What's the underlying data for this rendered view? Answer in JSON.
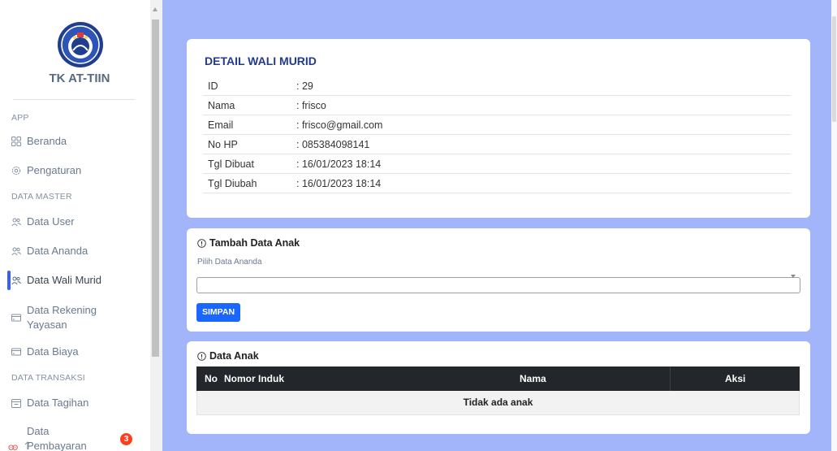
{
  "sidebar": {
    "brand": "TK AT-TIIN",
    "headers": {
      "app": "APP",
      "master": "DATA MASTER",
      "transaksi": "DATA TRANSAKSI"
    },
    "items": {
      "beranda": "Beranda",
      "pengaturan": "Pengaturan",
      "data_user": "Data User",
      "data_ananda": "Data Ananda",
      "data_wali_murid": "Data Wali Murid",
      "data_rekening_1": "Data Rekening",
      "data_rekening_2": "Yayasan",
      "data_biaya": "Data Biaya",
      "data_tagihan": "Data Tagihan",
      "data_pembayaran_1": "Data",
      "data_pembayaran_2": "Pembayaran"
    },
    "pembayaran_badge": "3",
    "accent_color": "#3b5cf6"
  },
  "detail": {
    "title": "DETAIL WALI MURID",
    "rows": [
      {
        "label": "ID",
        "value": ": 29"
      },
      {
        "label": "Nama",
        "value": ": frisco"
      },
      {
        "label": "Email",
        "value": ": frisco@gmail.com"
      },
      {
        "label": "No HP",
        "value": ": 085384098141"
      },
      {
        "label": "Tgl Dibuat",
        "value": ": 16/01/2023 18:14"
      },
      {
        "label": "Tgl Diubah",
        "value": ": 16/01/2023 18:14"
      }
    ]
  },
  "tambah": {
    "title": "Tambah Data Anak",
    "select_label": "Pilih Data Ananda",
    "select_value": "",
    "button": "SIMPAN",
    "button_color": "#1a66ff"
  },
  "anak": {
    "title": "Data Anak",
    "columns": {
      "no": "No",
      "nomor_induk": "Nomor Induk",
      "nama": "Nama",
      "aksi": "Aksi"
    },
    "empty": "Tidak ada anak"
  },
  "colors": {
    "background": "#a2b5fb",
    "title": "#233a8e"
  }
}
